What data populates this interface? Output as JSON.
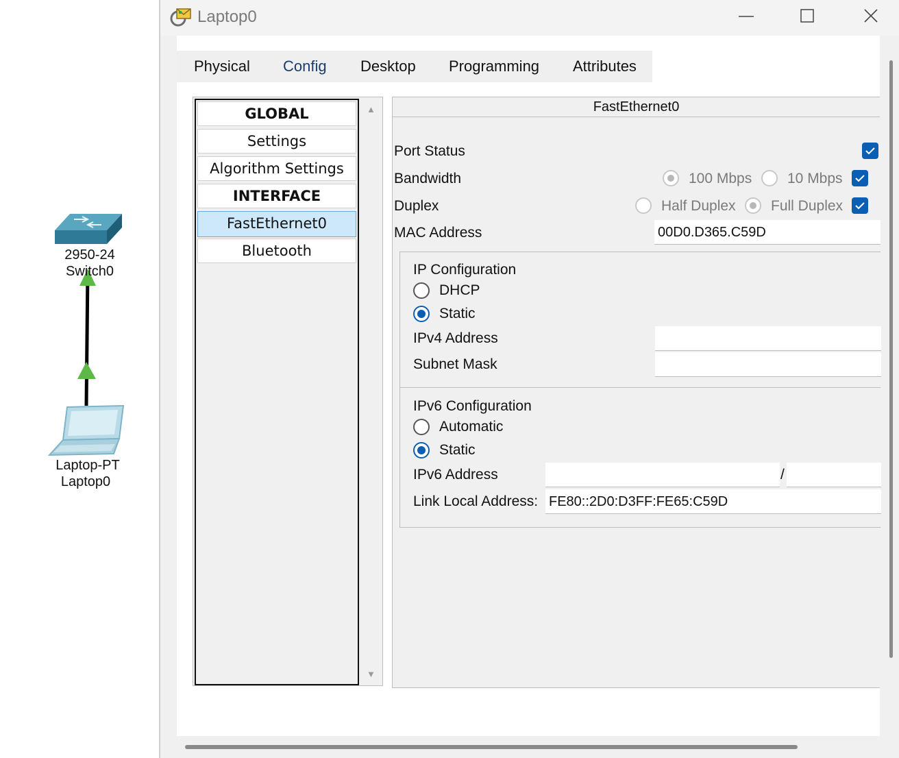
{
  "window": {
    "title": "Laptop0",
    "controls": [
      "minimize",
      "maximize",
      "close"
    ]
  },
  "topology": {
    "switch": {
      "model": "2950-24",
      "name": "Switch0"
    },
    "laptop": {
      "model": "Laptop-PT",
      "name": "Laptop0"
    },
    "link_color": "#000000",
    "link_status_color": "#5cb947"
  },
  "tabs": [
    {
      "label": "Physical",
      "active": false
    },
    {
      "label": "Config",
      "active": true
    },
    {
      "label": "Desktop",
      "active": false
    },
    {
      "label": "Programming",
      "active": false
    },
    {
      "label": "Attributes",
      "active": false
    }
  ],
  "sidebar": {
    "items": [
      {
        "label": "GLOBAL",
        "type": "header"
      },
      {
        "label": "Settings",
        "type": "item"
      },
      {
        "label": "Algorithm Settings",
        "type": "item"
      },
      {
        "label": "INTERFACE",
        "type": "header"
      },
      {
        "label": "FastEthernet0",
        "type": "item",
        "selected": true
      },
      {
        "label": "Bluetooth",
        "type": "item"
      }
    ]
  },
  "interface": {
    "title": "FastEthernet0",
    "port_status": {
      "label": "Port Status",
      "checked": true
    },
    "bandwidth": {
      "label": "Bandwidth",
      "options": [
        "100 Mbps",
        "10 Mbps"
      ],
      "selected": "100 Mbps",
      "auto_checked": true
    },
    "duplex": {
      "label": "Duplex",
      "options": [
        "Half Duplex",
        "Full Duplex"
      ],
      "selected": "Full Duplex",
      "auto_checked": true
    },
    "mac": {
      "label": "MAC Address",
      "value": "00D0.D365.C59D"
    }
  },
  "ip_config": {
    "title": "IP Configuration",
    "options": [
      "DHCP",
      "Static"
    ],
    "selected": "Static",
    "ipv4_label": "IPv4 Address",
    "ipv4_value": "",
    "mask_label": "Subnet Mask",
    "mask_value": ""
  },
  "ipv6_config": {
    "title": "IPv6 Configuration",
    "options": [
      "Automatic",
      "Static"
    ],
    "selected": "Static",
    "address_label": "IPv6 Address",
    "address_value": "",
    "prefix_separator": "/",
    "prefix_value": "",
    "link_local_label": "Link Local Address:",
    "link_local_value": "FE80::2D0:D3FF:FE65:C59D"
  },
  "colors": {
    "accent": "#0a5fb4",
    "tab_underline": "#0f2b57",
    "selected_item": "#cde8fb"
  }
}
